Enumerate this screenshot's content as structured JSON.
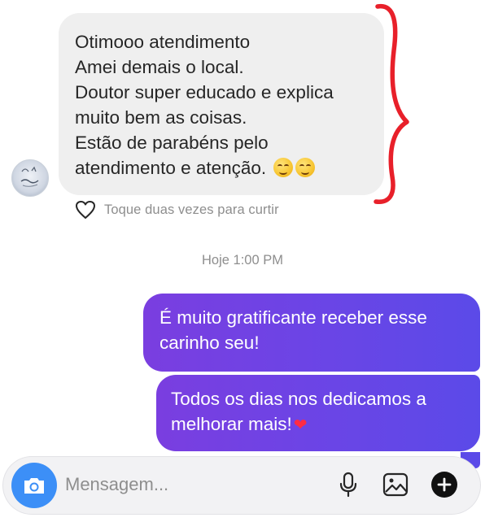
{
  "incoming_message": {
    "lines": [
      "Otimooo atendimento",
      "Amei demais o local.",
      "Doutor super educado e explica",
      "muito bem as coisas.",
      "Estão  de parabéns pelo",
      "atendimento e atenção."
    ],
    "emojis": [
      "smiling-face-icon",
      "winking-face-icon"
    ],
    "annotation_color": "#e8202a"
  },
  "like_hint": "Toque duas vezes para curtir",
  "timestamp": "Hoje 1:00 PM",
  "outgoing_messages": [
    {
      "lines": [
        "É muito gratificante receber esse",
        "carinho seu!"
      ]
    },
    {
      "lines": [
        "Todos os dias nos dedicamos a",
        "melhorar mais!"
      ],
      "emoji": "red-heart-icon"
    }
  ],
  "composer": {
    "placeholder": "Mensagem...",
    "icons": [
      "camera-icon",
      "microphone-icon",
      "gallery-icon",
      "plus-icon"
    ]
  },
  "colors": {
    "incoming_bubble": "#efefef",
    "outgoing_bubble_start": "#7a3ee0",
    "outgoing_bubble_end": "#5b4ae8",
    "camera_button": "#3c8ff7",
    "secondary_text": "#8e8e8e"
  }
}
